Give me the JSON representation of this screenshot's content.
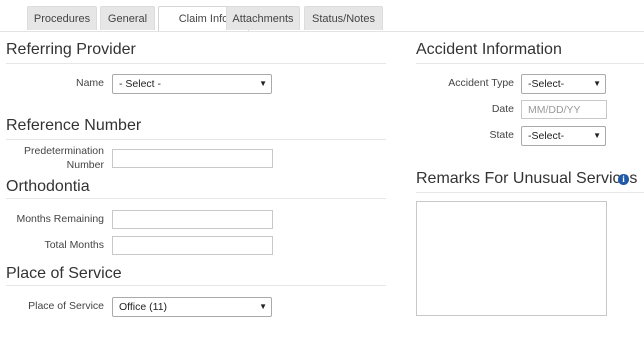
{
  "tabs": [
    {
      "label": "Procedures"
    },
    {
      "label": "General"
    },
    {
      "label": "Claim Info",
      "active": true
    },
    {
      "label": "Attachments"
    },
    {
      "label": "Status/Notes"
    }
  ],
  "referring_provider": {
    "heading": "Referring Provider",
    "name_label": "Name",
    "name_value": "- Select -"
  },
  "reference_number": {
    "heading": "Reference Number",
    "predetermination_label_line1": "Predetermination",
    "predetermination_label_line2": "Number",
    "predetermination_value": ""
  },
  "orthodontia": {
    "heading": "Orthodontia",
    "months_remaining_label": "Months Remaining",
    "months_remaining_value": "",
    "total_months_label": "Total Months",
    "total_months_value": ""
  },
  "place_of_service": {
    "heading": "Place of Service",
    "label": "Place of Service",
    "value": "Office (11)"
  },
  "accident_information": {
    "heading": "Accident Information",
    "accident_type_label": "Accident Type",
    "accident_type_value": "-Select-",
    "date_label": "Date",
    "date_placeholder": "MM/DD/YY",
    "state_label": "State",
    "state_value": "-Select-"
  },
  "remarks": {
    "heading": "Remarks For Unusual Services",
    "value": ""
  },
  "icons": {
    "caret": "chevron-down-icon",
    "info": "info-icon"
  }
}
